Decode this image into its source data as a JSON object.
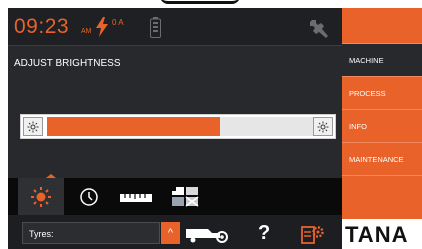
{
  "header": {
    "time": "09:23",
    "time_suffix": "AM",
    "current": "0 A"
  },
  "page": {
    "title": "ADJUST BRIGHTNESS"
  },
  "brightness": {
    "level": 0.65
  },
  "tabs": [
    {
      "name": "brightness",
      "active": true
    },
    {
      "name": "clock",
      "active": false
    },
    {
      "name": "units",
      "active": false
    },
    {
      "name": "language",
      "active": false
    }
  ],
  "status": {
    "tyres_label": "Tyres:"
  },
  "menu": {
    "items": [
      {
        "label": "MACHINE"
      },
      {
        "label": "PROCESS"
      },
      {
        "label": "INFO"
      },
      {
        "label": "MAINTENANCE"
      }
    ],
    "brand": "TANA"
  },
  "colors": {
    "accent": "#e8622a",
    "panel": "#27292c",
    "bar": "#0a0a0a"
  }
}
